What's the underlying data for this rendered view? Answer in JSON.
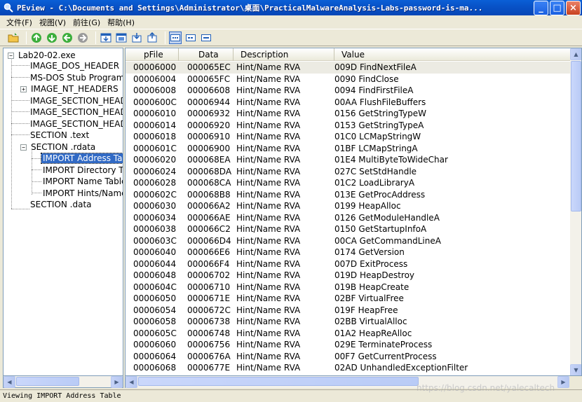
{
  "window": {
    "title": "PEview - C:\\Documents and Settings\\Administrator\\桌面\\PracticalMalwareAnalysis-Labs-password-is-ma...",
    "minimize_label": "_",
    "maximize_label": "□",
    "close_label": "×"
  },
  "menu": [
    {
      "label": "文件(F)"
    },
    {
      "label": "视图(V)"
    },
    {
      "label": "前往(G)"
    },
    {
      "label": "帮助(H)"
    }
  ],
  "toolbar": {
    "buttons": [
      "open-icon",
      "back-icon",
      "forward-icon",
      "previous-icon",
      "next-icon",
      "view-hex-icon",
      "view-section-icon",
      "export-icon",
      "import-icon",
      "view-bytes-icon",
      "view-words-icon",
      "view-dwords-icon"
    ]
  },
  "tree": {
    "items": [
      {
        "label": "Lab20-02.exe",
        "level": 0,
        "expander": "−"
      },
      {
        "label": "IMAGE_DOS_HEADER",
        "level": 1
      },
      {
        "label": "MS-DOS Stub Program",
        "level": 1
      },
      {
        "label": "IMAGE_NT_HEADERS",
        "level": 1,
        "expander": "+"
      },
      {
        "label": "IMAGE_SECTION_HEADER",
        "level": 1
      },
      {
        "label": "IMAGE_SECTION_HEADER",
        "level": 1
      },
      {
        "label": "IMAGE_SECTION_HEADER",
        "level": 1
      },
      {
        "label": "SECTION .text",
        "level": 1
      },
      {
        "label": "SECTION .rdata",
        "level": 1,
        "expander": "−"
      },
      {
        "label": "IMPORT Address Table",
        "level": 2,
        "selected": true
      },
      {
        "label": "IMPORT Directory Table",
        "level": 2
      },
      {
        "label": "IMPORT Name Table",
        "level": 2
      },
      {
        "label": "IMPORT Hints/Names",
        "level": 2
      },
      {
        "label": "SECTION .data",
        "level": 1
      }
    ]
  },
  "grid": {
    "columns": [
      "pFile",
      "Data",
      "Description",
      "Value"
    ],
    "rows": [
      {
        "pfile": "00006000",
        "data": "000065EC",
        "desc": "Hint/Name RVA",
        "value": "009D  FindNextFileA"
      },
      {
        "pfile": "00006004",
        "data": "000065FC",
        "desc": "Hint/Name RVA",
        "value": "0090  FindClose"
      },
      {
        "pfile": "00006008",
        "data": "00006608",
        "desc": "Hint/Name RVA",
        "value": "0094  FindFirstFileA"
      },
      {
        "pfile": "0000600C",
        "data": "00006944",
        "desc": "Hint/Name RVA",
        "value": "00AA  FlushFileBuffers"
      },
      {
        "pfile": "00006010",
        "data": "00006932",
        "desc": "Hint/Name RVA",
        "value": "0156  GetStringTypeW"
      },
      {
        "pfile": "00006014",
        "data": "00006920",
        "desc": "Hint/Name RVA",
        "value": "0153  GetStringTypeA"
      },
      {
        "pfile": "00006018",
        "data": "00006910",
        "desc": "Hint/Name RVA",
        "value": "01C0  LCMapStringW"
      },
      {
        "pfile": "0000601C",
        "data": "00006900",
        "desc": "Hint/Name RVA",
        "value": "01BF  LCMapStringA"
      },
      {
        "pfile": "00006020",
        "data": "000068EA",
        "desc": "Hint/Name RVA",
        "value": "01E4  MultiByteToWideChar"
      },
      {
        "pfile": "00006024",
        "data": "000068DA",
        "desc": "Hint/Name RVA",
        "value": "027C  SetStdHandle"
      },
      {
        "pfile": "00006028",
        "data": "000068CA",
        "desc": "Hint/Name RVA",
        "value": "01C2  LoadLibraryA"
      },
      {
        "pfile": "0000602C",
        "data": "000068B8",
        "desc": "Hint/Name RVA",
        "value": "013E  GetProcAddress"
      },
      {
        "pfile": "00006030",
        "data": "000066A2",
        "desc": "Hint/Name RVA",
        "value": "0199  HeapAlloc"
      },
      {
        "pfile": "00006034",
        "data": "000066AE",
        "desc": "Hint/Name RVA",
        "value": "0126  GetModuleHandleA"
      },
      {
        "pfile": "00006038",
        "data": "000066C2",
        "desc": "Hint/Name RVA",
        "value": "0150  GetStartupInfoA"
      },
      {
        "pfile": "0000603C",
        "data": "000066D4",
        "desc": "Hint/Name RVA",
        "value": "00CA  GetCommandLineA"
      },
      {
        "pfile": "00006040",
        "data": "000066E6",
        "desc": "Hint/Name RVA",
        "value": "0174  GetVersion"
      },
      {
        "pfile": "00006044",
        "data": "000066F4",
        "desc": "Hint/Name RVA",
        "value": "007D  ExitProcess"
      },
      {
        "pfile": "00006048",
        "data": "00006702",
        "desc": "Hint/Name RVA",
        "value": "019D  HeapDestroy"
      },
      {
        "pfile": "0000604C",
        "data": "00006710",
        "desc": "Hint/Name RVA",
        "value": "019B  HeapCreate"
      },
      {
        "pfile": "00006050",
        "data": "0000671E",
        "desc": "Hint/Name RVA",
        "value": "02BF  VirtualFree"
      },
      {
        "pfile": "00006054",
        "data": "0000672C",
        "desc": "Hint/Name RVA",
        "value": "019F  HeapFree"
      },
      {
        "pfile": "00006058",
        "data": "00006738",
        "desc": "Hint/Name RVA",
        "value": "02BB  VirtualAlloc"
      },
      {
        "pfile": "0000605C",
        "data": "00006748",
        "desc": "Hint/Name RVA",
        "value": "01A2  HeapReAlloc"
      },
      {
        "pfile": "00006060",
        "data": "00006756",
        "desc": "Hint/Name RVA",
        "value": "029E  TerminateProcess"
      },
      {
        "pfile": "00006064",
        "data": "0000676A",
        "desc": "Hint/Name RVA",
        "value": "00F7  GetCurrentProcess"
      },
      {
        "pfile": "00006068",
        "data": "0000677E",
        "desc": "Hint/Name RVA",
        "value": "02AD  UnhandledExceptionFilter"
      }
    ]
  },
  "status": {
    "text": "Viewing IMPORT Address Table"
  },
  "watermark": "https://blog.csdn.net/yalecaltech"
}
